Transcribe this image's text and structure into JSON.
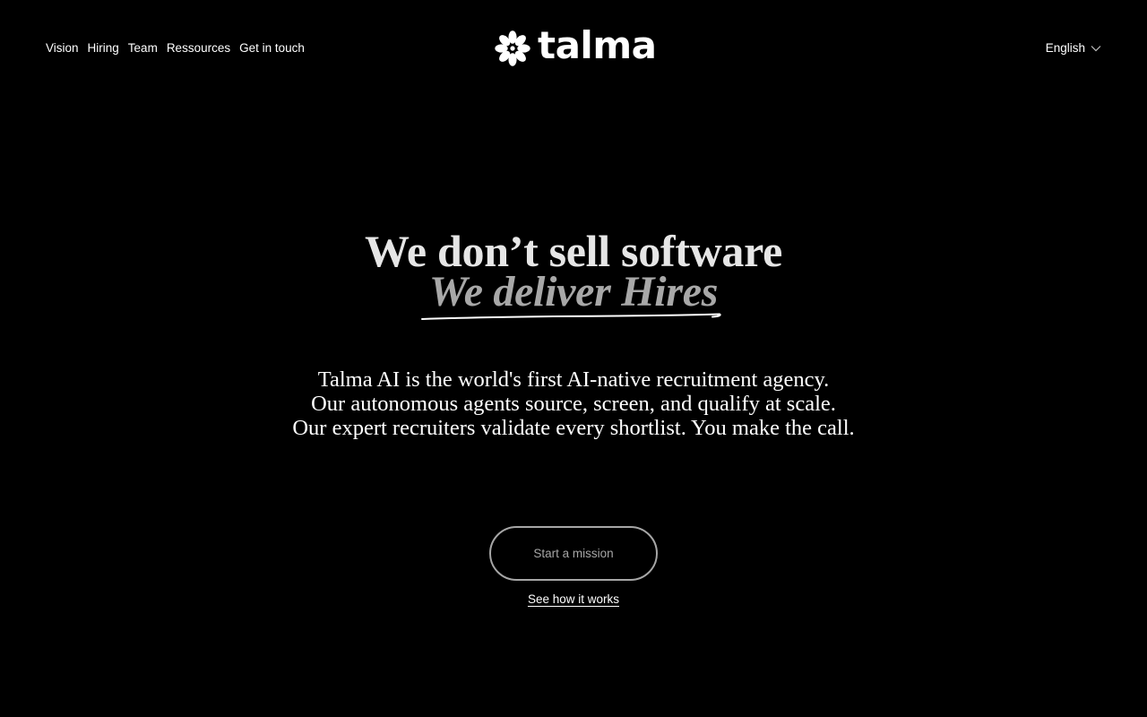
{
  "header": {
    "nav": [
      {
        "label": "Vision"
      },
      {
        "label": "Hiring"
      },
      {
        "label": "Team"
      },
      {
        "label": "Ressources"
      },
      {
        "label": "Get in touch"
      }
    ],
    "logo": {
      "wordmark": "talma",
      "icon": "flower-logo-icon"
    },
    "language": {
      "selected": "English",
      "icon": "chevron-down-icon"
    }
  },
  "hero": {
    "headline": "We don’t sell software",
    "subheadline": "We deliver Hires",
    "description": [
      "Talma AI is the world's first AI-native recruitment agency.",
      "Our autonomous agents source, screen, and qualify at scale.",
      "Our expert recruiters validate every shortlist. You make the call."
    ],
    "cta_label": "Start a mission",
    "secondary_link": "See how it works"
  },
  "colors": {
    "background": "#000000",
    "text": "#ffffff",
    "headline": "#e6e6e6",
    "subheadline": "#a8a8a8",
    "button_border": "#a6a6a6"
  }
}
